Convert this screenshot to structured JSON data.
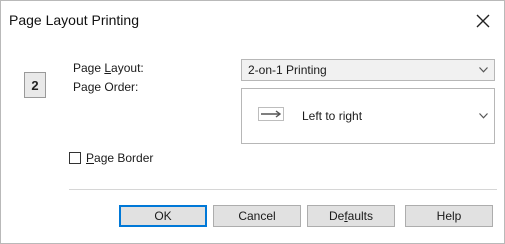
{
  "window": {
    "title": "Page Layout Printing"
  },
  "page_indicator": "2",
  "page_layout": {
    "label_prefix": "Page ",
    "label_underlined": "L",
    "label_suffix": "ayout:",
    "value": "2-on-1 Printing"
  },
  "page_order": {
    "label_prefix": "Pa",
    "label_underlined": "g",
    "label_suffix": "e Order:",
    "value": "Left to right"
  },
  "page_border": {
    "label_underlined": "P",
    "label_suffix": "age Border",
    "checked": false
  },
  "buttons": {
    "ok": "OK",
    "cancel": "Cancel",
    "defaults_prefix": "De",
    "defaults_underlined": "f",
    "defaults_suffix": "aults",
    "help": "Help"
  },
  "icons": {
    "close": "close-icon",
    "dropdown": "chevron-down-icon",
    "order": "page-order-icon"
  }
}
